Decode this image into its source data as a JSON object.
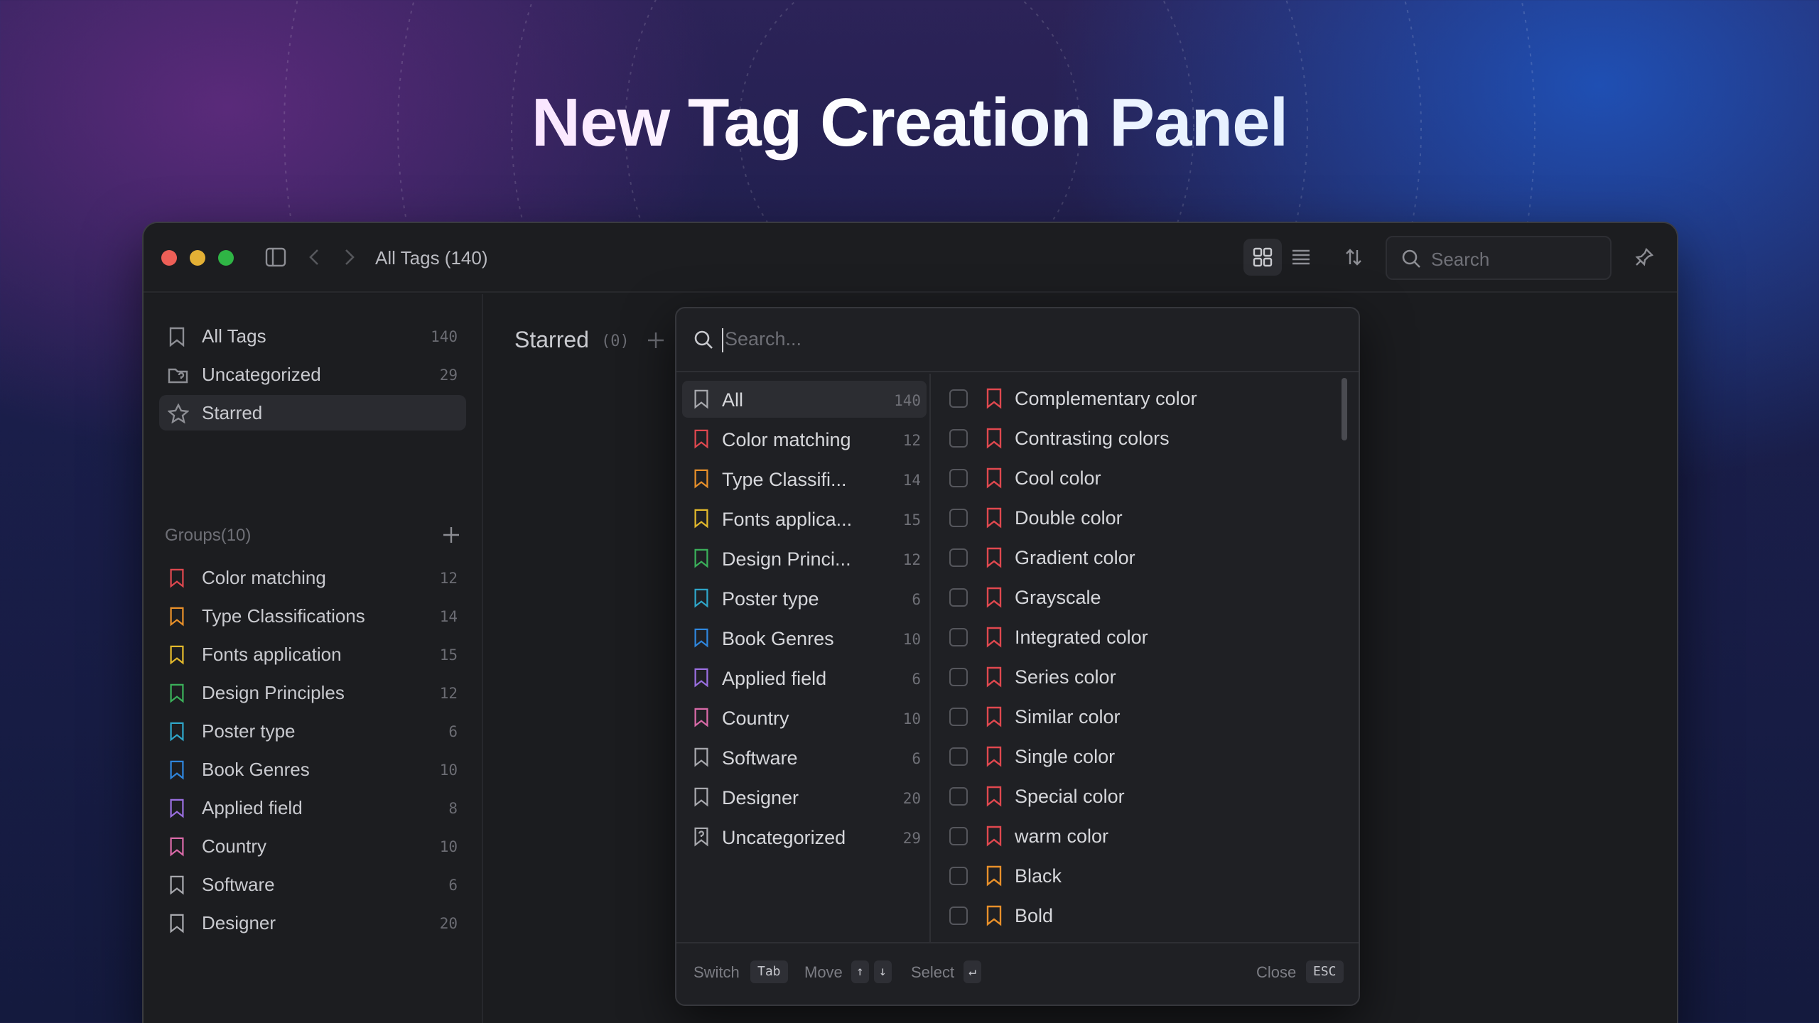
{
  "hero": {
    "title": "New Tag Creation Panel"
  },
  "window": {
    "title": "All Tags (140)",
    "search_placeholder": "Search"
  },
  "sidebar": {
    "top_items": [
      {
        "label": "All Tags",
        "count": "140",
        "icon": "bookmark-icon"
      },
      {
        "label": "Uncategorized",
        "count": "29",
        "icon": "folder-question-icon"
      },
      {
        "label": "Starred",
        "count": "",
        "icon": "star-icon"
      }
    ],
    "groups_label": "Groups(10)",
    "groups": [
      {
        "label": "Color matching",
        "count": "12",
        "color": "#e0484f"
      },
      {
        "label": "Type Classifications",
        "count": "14",
        "color": "#e8902a"
      },
      {
        "label": "Fonts application",
        "count": "15",
        "color": "#e3b92c"
      },
      {
        "label": "Design Principles",
        "count": "12",
        "color": "#3bb05a"
      },
      {
        "label": "Poster type",
        "count": "6",
        "color": "#2fa6c9"
      },
      {
        "label": "Book Genres",
        "count": "10",
        "color": "#2f86dd"
      },
      {
        "label": "Applied field",
        "count": "8",
        "color": "#9a6fe0"
      },
      {
        "label": "Country",
        "count": "10",
        "color": "#d96aa8"
      },
      {
        "label": "Software",
        "count": "6",
        "color": "#a8a9ae"
      },
      {
        "label": "Designer",
        "count": "20",
        "color": "#a8a9ae"
      }
    ]
  },
  "main": {
    "section_title": "Starred",
    "section_count": "(0)"
  },
  "panel": {
    "search_placeholder": "Search...",
    "groups": [
      {
        "label": "All",
        "count": "140",
        "color": "#a8a9ae"
      },
      {
        "label": "Color matching",
        "count": "12",
        "color": "#e0484f"
      },
      {
        "label": "Type Classifi...",
        "count": "14",
        "color": "#e8902a"
      },
      {
        "label": "Fonts applica...",
        "count": "15",
        "color": "#e3b92c"
      },
      {
        "label": "Design Princi...",
        "count": "12",
        "color": "#3bb05a"
      },
      {
        "label": "Poster type",
        "count": "6",
        "color": "#2fa6c9"
      },
      {
        "label": "Book Genres",
        "count": "10",
        "color": "#2f86dd"
      },
      {
        "label": "Applied field",
        "count": "6",
        "color": "#9a6fe0"
      },
      {
        "label": "Country",
        "count": "10",
        "color": "#d96aa8"
      },
      {
        "label": "Software",
        "count": "6",
        "color": "#a8a9ae"
      },
      {
        "label": "Designer",
        "count": "20",
        "color": "#a8a9ae"
      },
      {
        "label": "Uncategorized",
        "count": "29",
        "color": "#a8a9ae"
      }
    ],
    "tags": [
      {
        "label": "Complementary color",
        "color": "#e0484f"
      },
      {
        "label": "Contrasting colors",
        "color": "#e0484f"
      },
      {
        "label": "Cool color",
        "color": "#e0484f"
      },
      {
        "label": "Double color",
        "color": "#e0484f"
      },
      {
        "label": "Gradient color",
        "color": "#e0484f"
      },
      {
        "label": "Grayscale",
        "color": "#e0484f"
      },
      {
        "label": "Integrated color",
        "color": "#e0484f"
      },
      {
        "label": "Series color",
        "color": "#e0484f"
      },
      {
        "label": "Similar color",
        "color": "#e0484f"
      },
      {
        "label": "Single color",
        "color": "#e0484f"
      },
      {
        "label": "Special color",
        "color": "#e0484f"
      },
      {
        "label": "warm color",
        "color": "#e0484f"
      },
      {
        "label": "Black",
        "color": "#e8902a"
      },
      {
        "label": "Bold",
        "color": "#e8902a"
      }
    ],
    "footer": {
      "switch_label": "Switch",
      "switch_key": "Tab",
      "move_label": "Move",
      "move_key_up": "↑",
      "move_key_down": "↓",
      "select_label": "Select",
      "select_key": "↵",
      "close_label": "Close",
      "close_key": "ESC"
    }
  }
}
